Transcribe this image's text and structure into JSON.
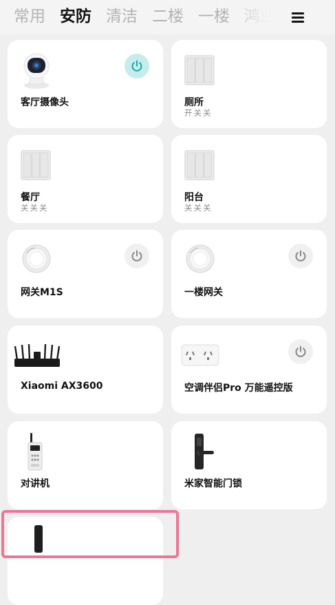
{
  "tabs": [
    {
      "label": "常用",
      "active": false
    },
    {
      "label": "安防",
      "active": true
    },
    {
      "label": "清洁",
      "active": false
    },
    {
      "label": "二楼",
      "active": false
    },
    {
      "label": "一楼",
      "active": false
    },
    {
      "label": "鸿业",
      "active": false
    }
  ],
  "menu_icon": "hamburger-menu-icon",
  "devices": [
    {
      "name": "客厅摄像头",
      "status": "",
      "icon": "camera-icon",
      "power": "on"
    },
    {
      "name": "厕所",
      "status": "开关关",
      "icon": "triple-switch-icon",
      "power": null
    },
    {
      "name": "餐厅",
      "status": "关关关",
      "icon": "triple-switch-icon",
      "power": null
    },
    {
      "name": "阳台",
      "status": "关关关",
      "icon": "triple-switch-icon",
      "power": null
    },
    {
      "name": "网关M1S",
      "status": "",
      "icon": "gateway-icon",
      "power": "off"
    },
    {
      "name": "一楼网关",
      "status": "",
      "icon": "gateway-icon",
      "power": "off"
    },
    {
      "name": "Xiaomi AX3600",
      "status": "",
      "icon": "router-icon",
      "power": null
    },
    {
      "name": "空调伴侣Pro 万能遥控版",
      "status": "",
      "icon": "ac-companion-icon",
      "power": "off"
    },
    {
      "name": "对讲机",
      "status": "",
      "icon": "walkie-talkie-icon",
      "power": null
    },
    {
      "name": "米家智能门锁",
      "status": "",
      "icon": "door-lock-icon",
      "power": null
    },
    {
      "name": "",
      "status": "",
      "icon": "remote-device-icon",
      "power": null
    }
  ],
  "colors": {
    "background": "#efefef",
    "card": "#ffffff",
    "power_on": "#c7ecec",
    "power_on_icon": "#1aa9a9",
    "highlight": "#ee7596"
  }
}
